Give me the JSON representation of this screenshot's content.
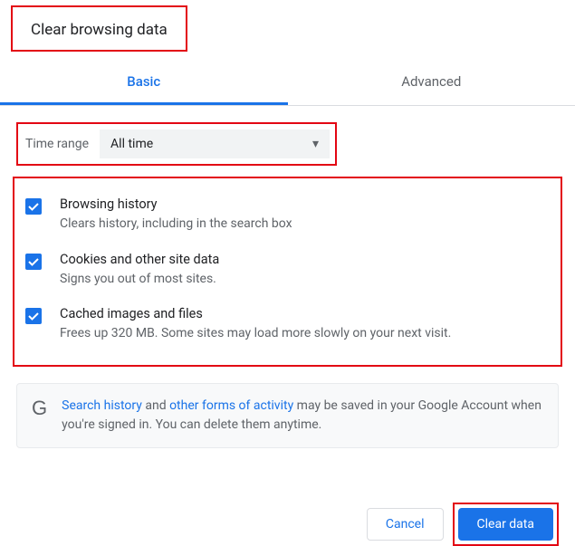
{
  "title": "Clear browsing data",
  "tabs": {
    "basic": "Basic",
    "advanced": "Advanced"
  },
  "timeRange": {
    "label": "Time range",
    "value": "All time"
  },
  "options": [
    {
      "title": "Browsing history",
      "desc": "Clears history, including in the search box",
      "checked": true
    },
    {
      "title": "Cookies and other site data",
      "desc": "Signs you out of most sites.",
      "checked": true
    },
    {
      "title": "Cached images and files",
      "desc": "Frees up 320 MB. Some sites may load more slowly on your next visit.",
      "checked": true
    }
  ],
  "info": {
    "link1": "Search history",
    "text1": " and ",
    "link2": "other forms of activity",
    "text2": " may be saved in your Google Account when you're signed in. You can delete them anytime."
  },
  "buttons": {
    "cancel": "Cancel",
    "clear": "Clear data"
  }
}
